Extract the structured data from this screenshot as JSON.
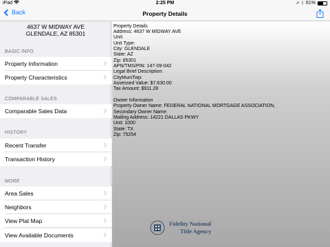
{
  "status_bar": {
    "carrier": "iPad",
    "time": "2:25 PM",
    "battery_text": "61%",
    "battery_level": 0.61
  },
  "nav": {
    "back_label": "Back",
    "title": "Property Details",
    "share_icon": "share-icon"
  },
  "sidebar": {
    "address_line1": "4637 W MIDWAY AVE",
    "address_line2": "GLENDALE, AZ 85301",
    "sections": {
      "basic_info": "BASIC INFO",
      "comparable_sales": "COMPARABLE SALES",
      "history": "HISTORY",
      "more": "MORE"
    },
    "items": {
      "property_information": "Property Information",
      "property_characteristics": "Property Characteristics",
      "comparable_sales_data": "Comparable Sales Data",
      "recent_transfer": "Recent Transfer",
      "transaction_history": "Transaction History",
      "area_sales": "Area Sales",
      "neighbors": "Neighbors",
      "view_plat_map": "View Plat Map",
      "view_available_documents": "View Available Documents"
    }
  },
  "details": {
    "lines": [
      "Property Details",
      "Address: 4637 W MIDWAY AVE",
      "Unit:",
      "Unit Type:",
      "City: GLENDALE",
      "State: AZ",
      "Zip: 85301",
      "APN/TMS/PIN: 147-09-042",
      "Legal Brief Description:",
      "CityMuniTwp:",
      "Assessed Value: $7,630.00",
      "Tax Amount: $911.28",
      "",
      "Owner Information",
      "Property Owner Name: FEDERAL NATIONAL MORTGAGE ASSOCIATION,",
      "Secondary Owner Name:",
      "Mailing Address: 14221 DALLAS PKWY",
      "Unit: 1000",
      "State: TX",
      "Zip: 75254"
    ]
  },
  "logo": {
    "line1": "Fidelity National",
    "line2": "Title Agency"
  },
  "colors": {
    "accent": "#1a7cf4",
    "logo": "#3a4e6e"
  }
}
